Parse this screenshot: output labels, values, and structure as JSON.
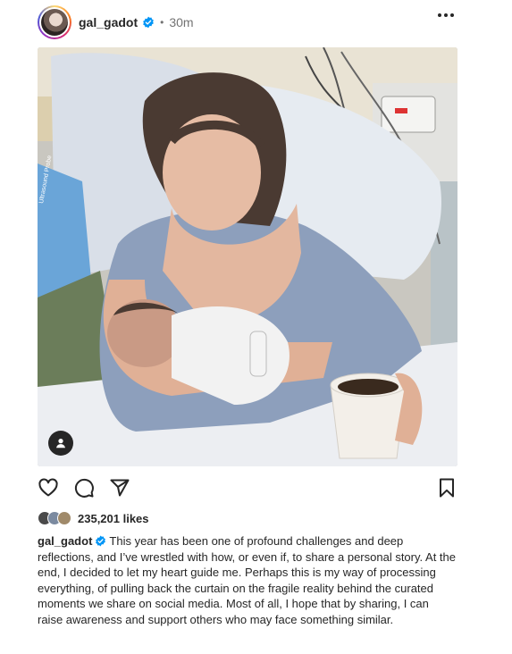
{
  "post": {
    "username": "gal_gadot",
    "separator": "•",
    "time_ago": "30m",
    "likes": "235,201 likes",
    "caption": "This year has been one of profound challenges and deep reflections, and I’ve wrestled with how, or even if, to share a personal story. At the end, I decided to let my heart guide me. Perhaps this is my way of processing everything, of pulling back the curtain on the fragile reality behind the curated moments we share on social media. Most of all, I hope that by sharing, I can raise awareness and support others who may face something similar.",
    "image_text": "Ultrasound Probe"
  },
  "icons": {
    "verified": "verified-badge-icon",
    "more": "more-options-icon",
    "like": "heart-icon",
    "comment": "comment-icon",
    "share": "send-icon",
    "save": "bookmark-icon",
    "user_tag": "user-tag-icon"
  },
  "colors": {
    "verified_blue": "#0095f6",
    "text": "#262626",
    "muted": "#737373"
  }
}
